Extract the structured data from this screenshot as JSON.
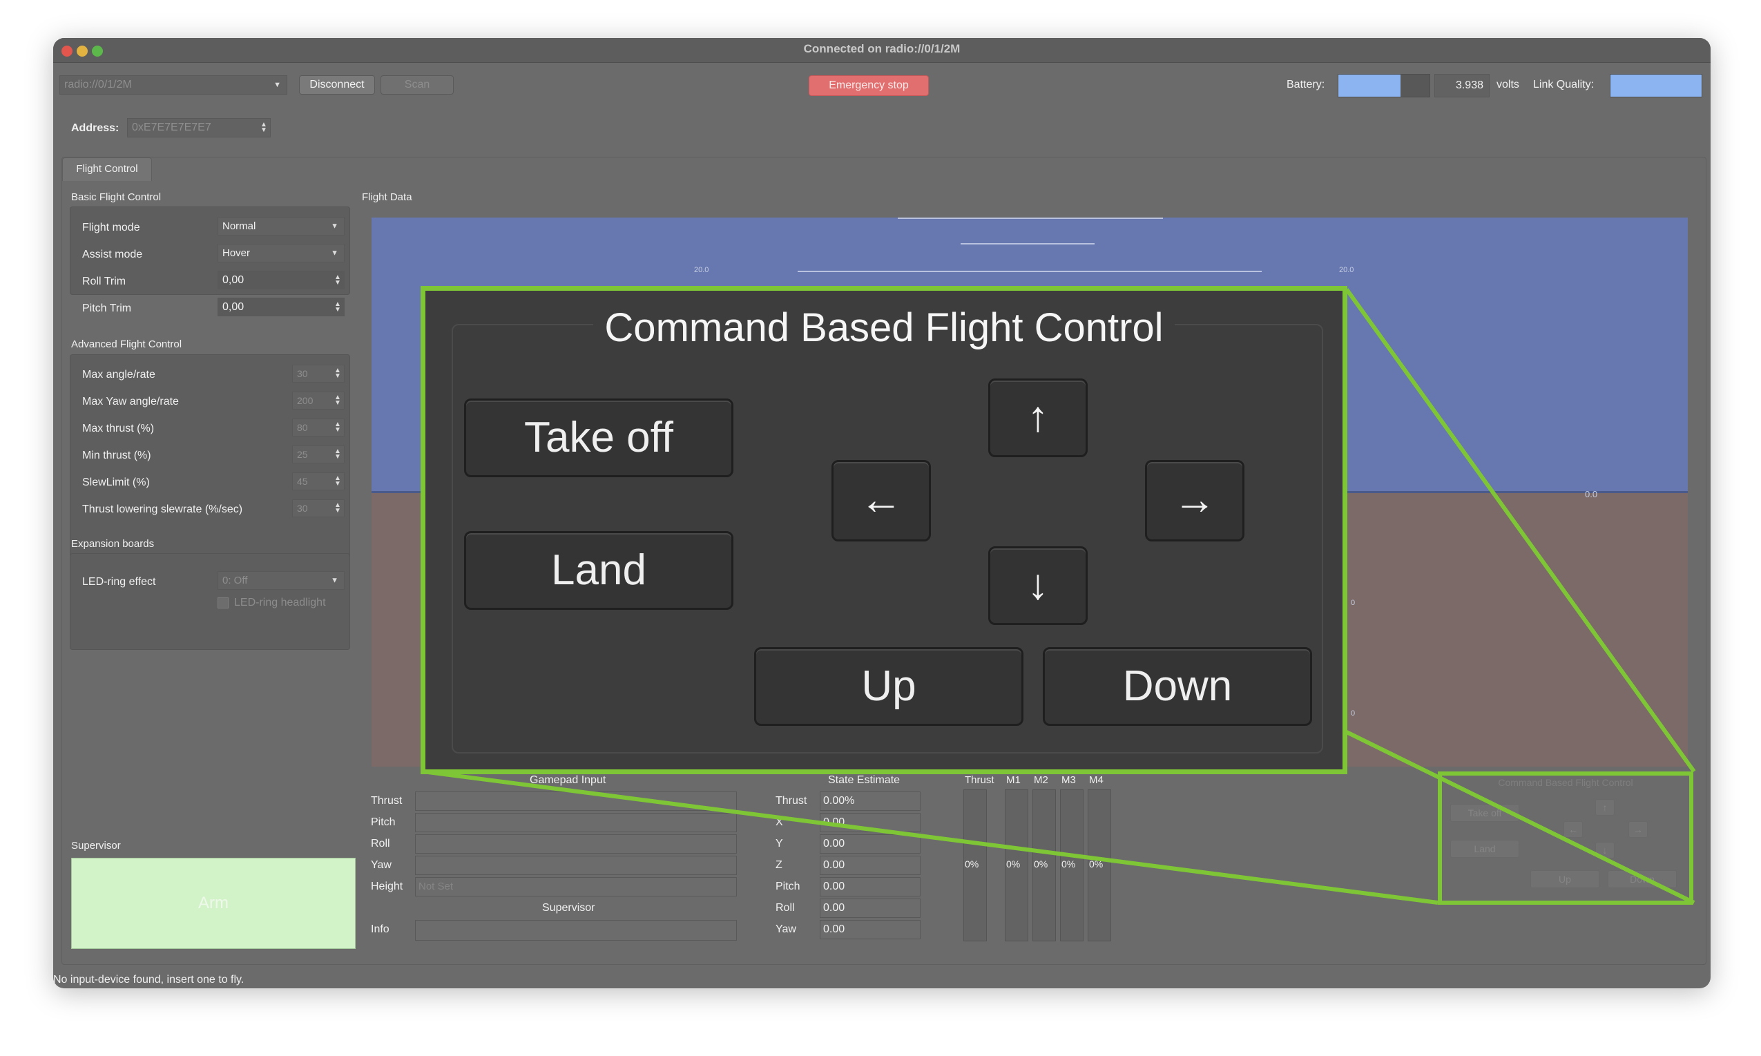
{
  "window": {
    "title": "Connected on radio://0/1/2M"
  },
  "toolbar": {
    "uri_select": "radio://0/1/2M",
    "disconnect_label": "Disconnect",
    "scan_label": "Scan",
    "emergency_label": "Emergency stop",
    "battery_label": "Battery:",
    "battery_level": 0.68,
    "battery_voltage": "3.938",
    "volts_label": "volts",
    "link_quality_label": "Link Quality:",
    "link_quality_level": 1.0
  },
  "address": {
    "label": "Address:",
    "value": "0xE7E7E7E7E7"
  },
  "tabs": [
    {
      "label": "Flight Control",
      "active": true
    }
  ],
  "basic": {
    "title": "Basic Flight Control",
    "flight_mode_label": "Flight mode",
    "flight_mode_value": "Normal",
    "assist_mode_label": "Assist mode",
    "assist_mode_value": "Hover",
    "roll_trim_label": "Roll Trim",
    "roll_trim_value": "0,00",
    "pitch_trim_label": "Pitch Trim",
    "pitch_trim_value": "0,00"
  },
  "advanced": {
    "title": "Advanced Flight Control",
    "rows": [
      {
        "label": "Max angle/rate",
        "value": "30"
      },
      {
        "label": "Max Yaw angle/rate",
        "value": "200"
      },
      {
        "label": "Max thrust (%)",
        "value": "80"
      },
      {
        "label": "Min thrust (%)",
        "value": "25"
      },
      {
        "label": "SlewLimit (%)",
        "value": "45"
      },
      {
        "label": "Thrust lowering slewrate (%/sec)",
        "value": "30"
      }
    ]
  },
  "expansion": {
    "title": "Expansion boards",
    "led_ring_label": "LED-ring effect",
    "led_ring_value": "0: Off",
    "led_headlight_label": "LED-ring headlight"
  },
  "supervisor": {
    "title": "Supervisor",
    "arm_label": "Arm"
  },
  "flight_data": {
    "title": "Flight Data",
    "labels": [
      "20.0",
      "20.0",
      "0.0",
      "0",
      "0"
    ]
  },
  "gamepad": {
    "title": "Gamepad Input",
    "rows": [
      {
        "label": "Thrust",
        "value": ""
      },
      {
        "label": "Pitch",
        "value": ""
      },
      {
        "label": "Roll",
        "value": ""
      },
      {
        "label": "Yaw",
        "value": ""
      },
      {
        "label": "Height",
        "value": "Not Set"
      }
    ],
    "supervisor_label": "Supervisor",
    "info_label": "Info"
  },
  "state_estimate": {
    "title": "State Estimate",
    "rows": [
      {
        "label": "Thrust",
        "value": "0.00%"
      },
      {
        "label": "X",
        "value": "0.00"
      },
      {
        "label": "Y",
        "value": "0.00"
      },
      {
        "label": "Z",
        "value": "0.00"
      },
      {
        "label": "Pitch",
        "value": "0.00"
      },
      {
        "label": "Roll",
        "value": "0.00"
      },
      {
        "label": "Yaw",
        "value": "0.00"
      }
    ]
  },
  "motors": {
    "headers": [
      "Thrust",
      "M1",
      "M2",
      "M3",
      "M4"
    ],
    "values": [
      "0%",
      "0%",
      "0%",
      "0%",
      "0%"
    ]
  },
  "command_control": {
    "title": "Command Based Flight Control",
    "take_off_label": "Take off",
    "land_label": "Land",
    "up_label": "Up",
    "down_label": "Down",
    "arrow_up": "↑",
    "arrow_left": "←",
    "arrow_right": "→",
    "arrow_down": "↓"
  },
  "status_bar": {
    "message": "No input-device found, insert one to fly."
  },
  "colors": {
    "highlight": "#7ec636",
    "emergency": "#e16f6f",
    "arm": "#d2f2c8",
    "battery": "#8cb4f0"
  }
}
